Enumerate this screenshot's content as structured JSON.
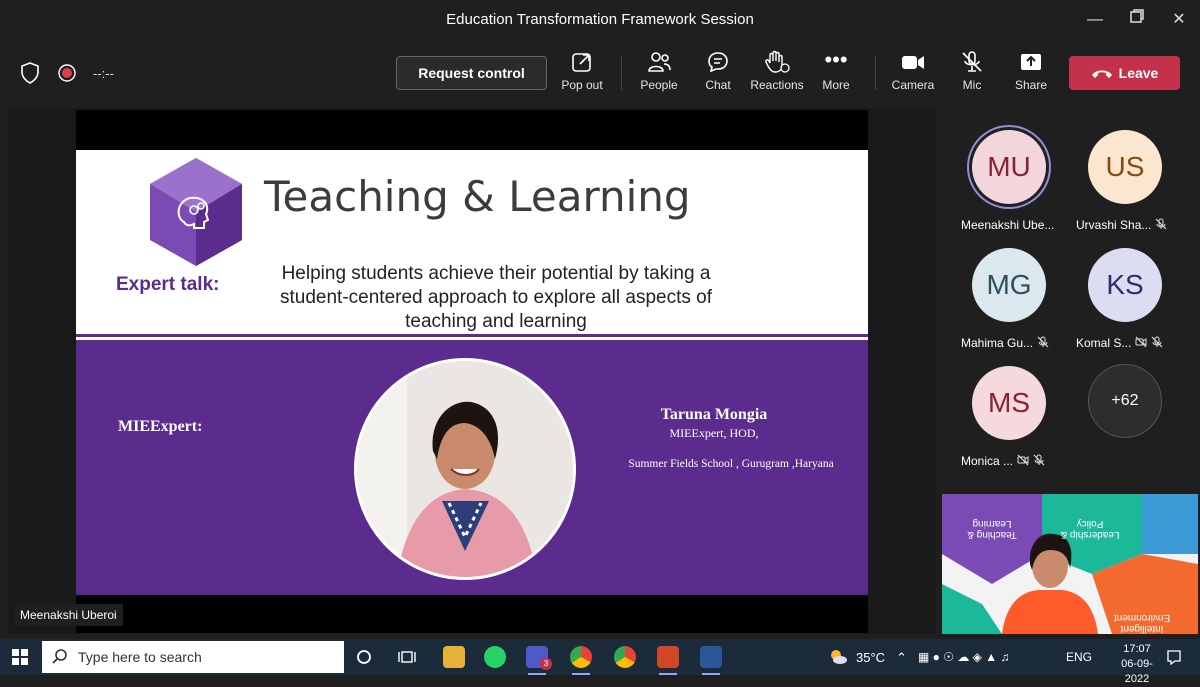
{
  "window": {
    "title": "Education Transformation Framework Session"
  },
  "meeting": {
    "timer": "--:--"
  },
  "toolbar": {
    "request_control": "Request control",
    "pop_out": "Pop out",
    "people": "People",
    "chat": "Chat",
    "reactions": "Reactions",
    "more": "More",
    "camera": "Camera",
    "mic": "Mic",
    "share": "Share",
    "leave": "Leave"
  },
  "slide": {
    "heading": "Teaching & Learning",
    "expert_label": "Expert talk:",
    "tagline_1": "Helping students achieve their potential by taking a",
    "tagline_2": "student-centered approach to explore all aspects of",
    "tagline_3": "teaching and learning",
    "mie_label": "MIEExpert:",
    "speaker_name": "Taruna Mongia",
    "speaker_role": "MIEExpert, HOD,",
    "speaker_school": "Summer Fields School , Gurugram ,Haryana"
  },
  "presenter_tag": "Meenakshi Uberoi",
  "participants": [
    {
      "initials": "MU",
      "name": "Meenakshi Ube...",
      "bg": "#f3d6dc",
      "fg": "#8a2233"
    },
    {
      "initials": "US",
      "name": "Urvashi Sha...",
      "bg": "#fbe6cf",
      "fg": "#8a4b10"
    },
    {
      "initials": "MG",
      "name": "Mahima Gu...",
      "bg": "#dbe8ee",
      "fg": "#2f4f5f"
    },
    {
      "initials": "KS",
      "name": "Komal S...",
      "bg": "#dcdcf3",
      "fg": "#2e2e6a"
    },
    {
      "initials": "MS",
      "name": "Monica ...",
      "bg": "#f6d9dc",
      "fg": "#8a2233"
    }
  ],
  "more_participants": "+62",
  "selfview": {
    "tile_1": "Teaching & Learning",
    "tile_2": "Leadership & Policy",
    "tile_3": "Intelligent Environment"
  },
  "taskbar": {
    "search_placeholder": "Type here to search",
    "weather": "35°C",
    "lang": "ENG",
    "time": "17:07",
    "date": "06-09-2022",
    "teams_badge": "3"
  },
  "colors": {
    "accent_purple": "#5b2c8e",
    "leave_red": "#c4314b",
    "taskbar": "#1c2b39"
  }
}
